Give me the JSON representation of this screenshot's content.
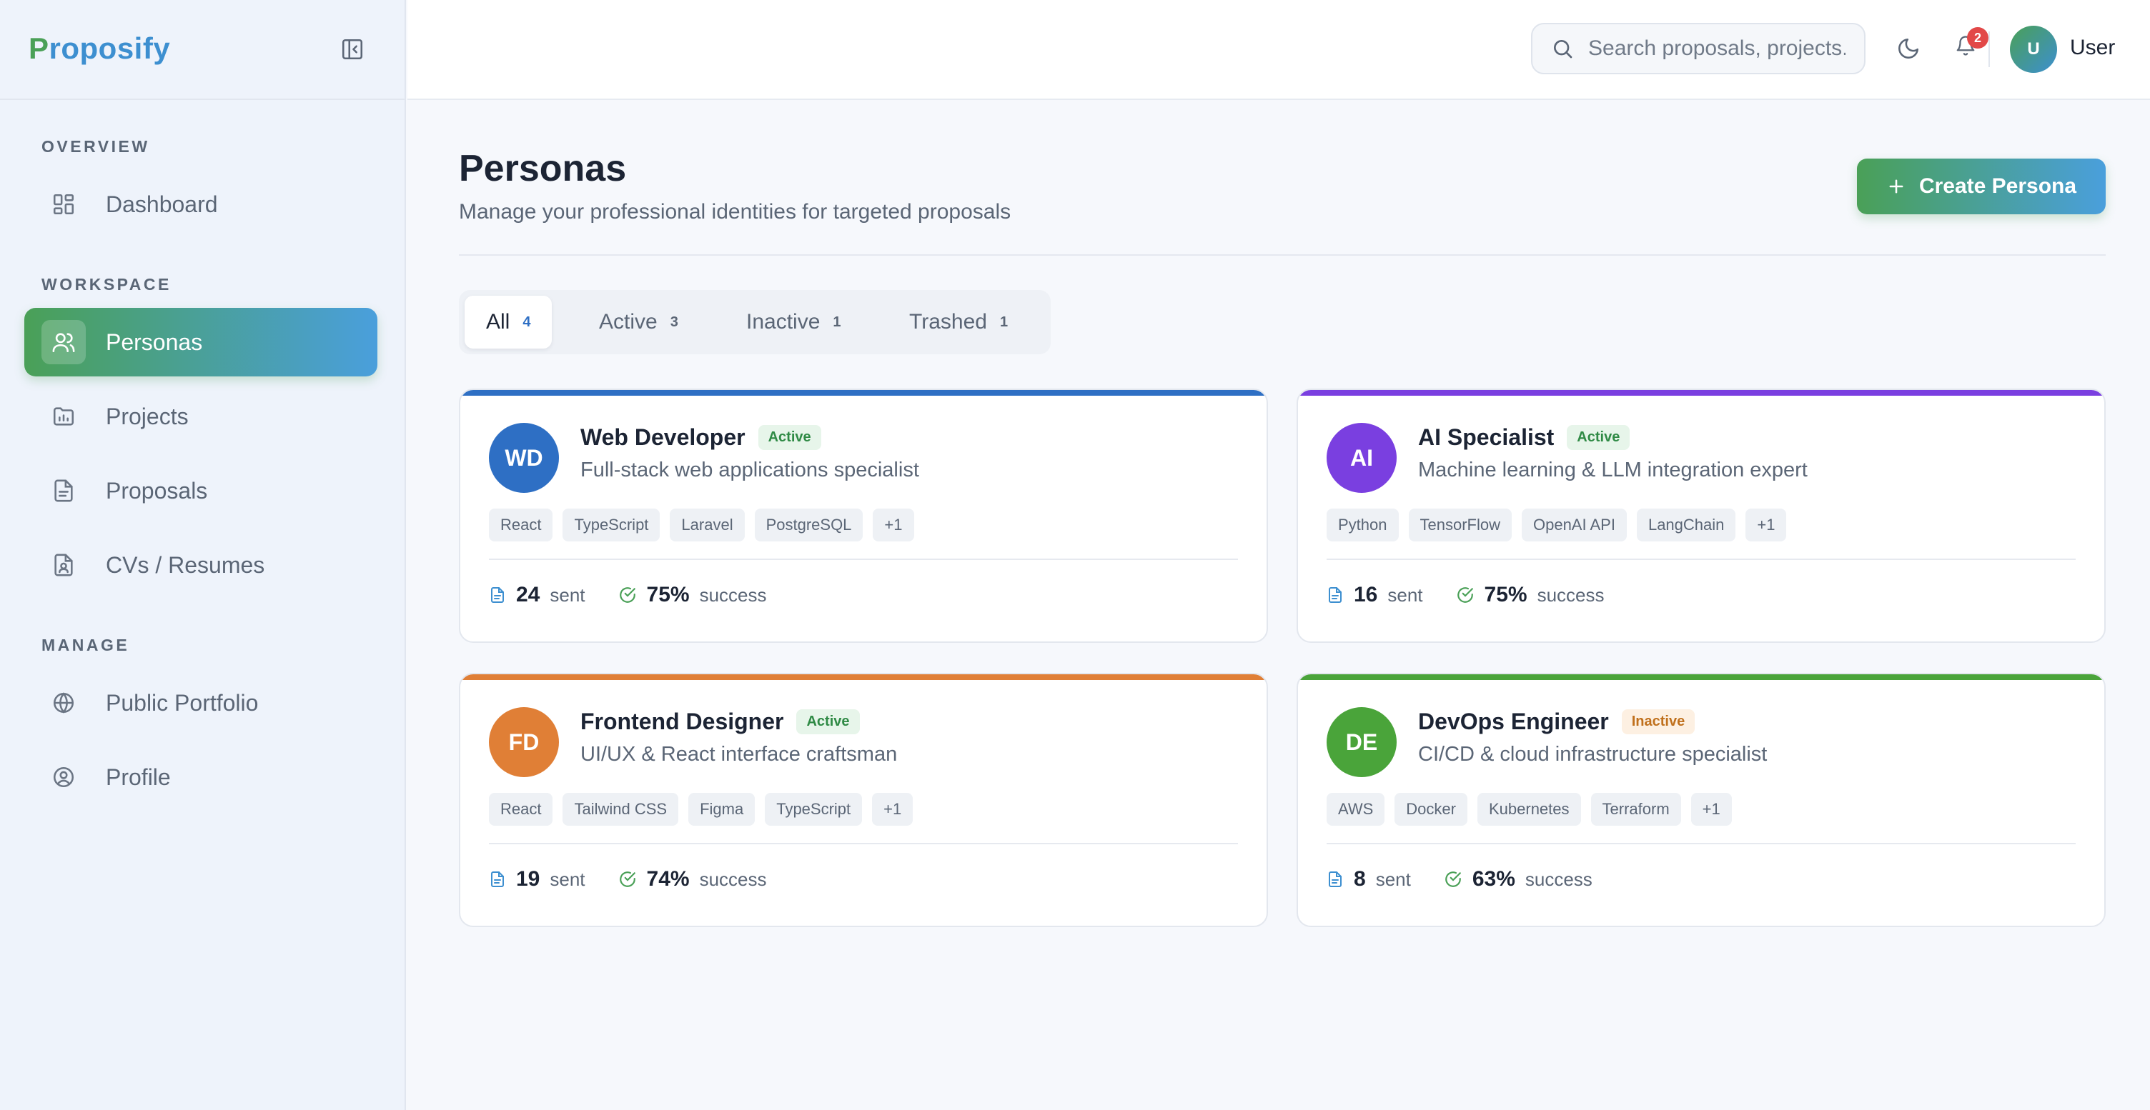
{
  "brand": {
    "first": "P",
    "rest": "roposify"
  },
  "sidebar": {
    "sections": [
      {
        "label": "OVERVIEW"
      },
      {
        "label": "WORKSPACE"
      },
      {
        "label": "MANAGE"
      }
    ],
    "items": [
      {
        "label": "Dashboard",
        "icon": "grid-icon"
      },
      {
        "label": "Personas",
        "icon": "users-icon",
        "active": true
      },
      {
        "label": "Projects",
        "icon": "folder-chart-icon"
      },
      {
        "label": "Proposals",
        "icon": "document-icon"
      },
      {
        "label": "CVs / Resumes",
        "icon": "file-user-icon"
      },
      {
        "label": "Public Portfolio",
        "icon": "globe-icon"
      },
      {
        "label": "Profile",
        "icon": "user-circle-icon"
      }
    ]
  },
  "header": {
    "search_placeholder": "Search proposals, projects...",
    "notification_count": "2",
    "user_initial": "U",
    "user_name": "User"
  },
  "page": {
    "title": "Personas",
    "subtitle": "Manage your professional identities for targeted proposals",
    "create_label": "Create Persona"
  },
  "tabs": [
    {
      "label": "All",
      "count": "4"
    },
    {
      "label": "Active",
      "count": "3"
    },
    {
      "label": "Inactive",
      "count": "1"
    },
    {
      "label": "Trashed",
      "count": "1"
    }
  ],
  "personas": [
    {
      "initials": "WD",
      "name": "Web Developer",
      "status": "Active",
      "description": "Full-stack web applications specialist",
      "tags": [
        "React",
        "TypeScript",
        "Laravel",
        "PostgreSQL",
        "+1"
      ],
      "sent": "24",
      "sent_label": "sent",
      "success": "75%",
      "success_label": "success",
      "color": "#2e6fc4"
    },
    {
      "initials": "AI",
      "name": "AI Specialist",
      "status": "Active",
      "description": "Machine learning & LLM integration expert",
      "tags": [
        "Python",
        "TensorFlow",
        "OpenAI API",
        "LangChain",
        "+1"
      ],
      "sent": "16",
      "sent_label": "sent",
      "success": "75%",
      "success_label": "success",
      "color": "#7a3fe0"
    },
    {
      "initials": "FD",
      "name": "Frontend Designer",
      "status": "Active",
      "description": "UI/UX & React interface craftsman",
      "tags": [
        "React",
        "Tailwind CSS",
        "Figma",
        "TypeScript",
        "+1"
      ],
      "sent": "19",
      "sent_label": "sent",
      "success": "74%",
      "success_label": "success",
      "color": "#e07f36"
    },
    {
      "initials": "DE",
      "name": "DevOps Engineer",
      "status": "Inactive",
      "description": "CI/CD & cloud infrastructure specialist",
      "tags": [
        "AWS",
        "Docker",
        "Kubernetes",
        "Terraform",
        "+1"
      ],
      "sent": "8",
      "sent_label": "sent",
      "success": "63%",
      "success_label": "success",
      "color": "#4aa43a"
    }
  ]
}
